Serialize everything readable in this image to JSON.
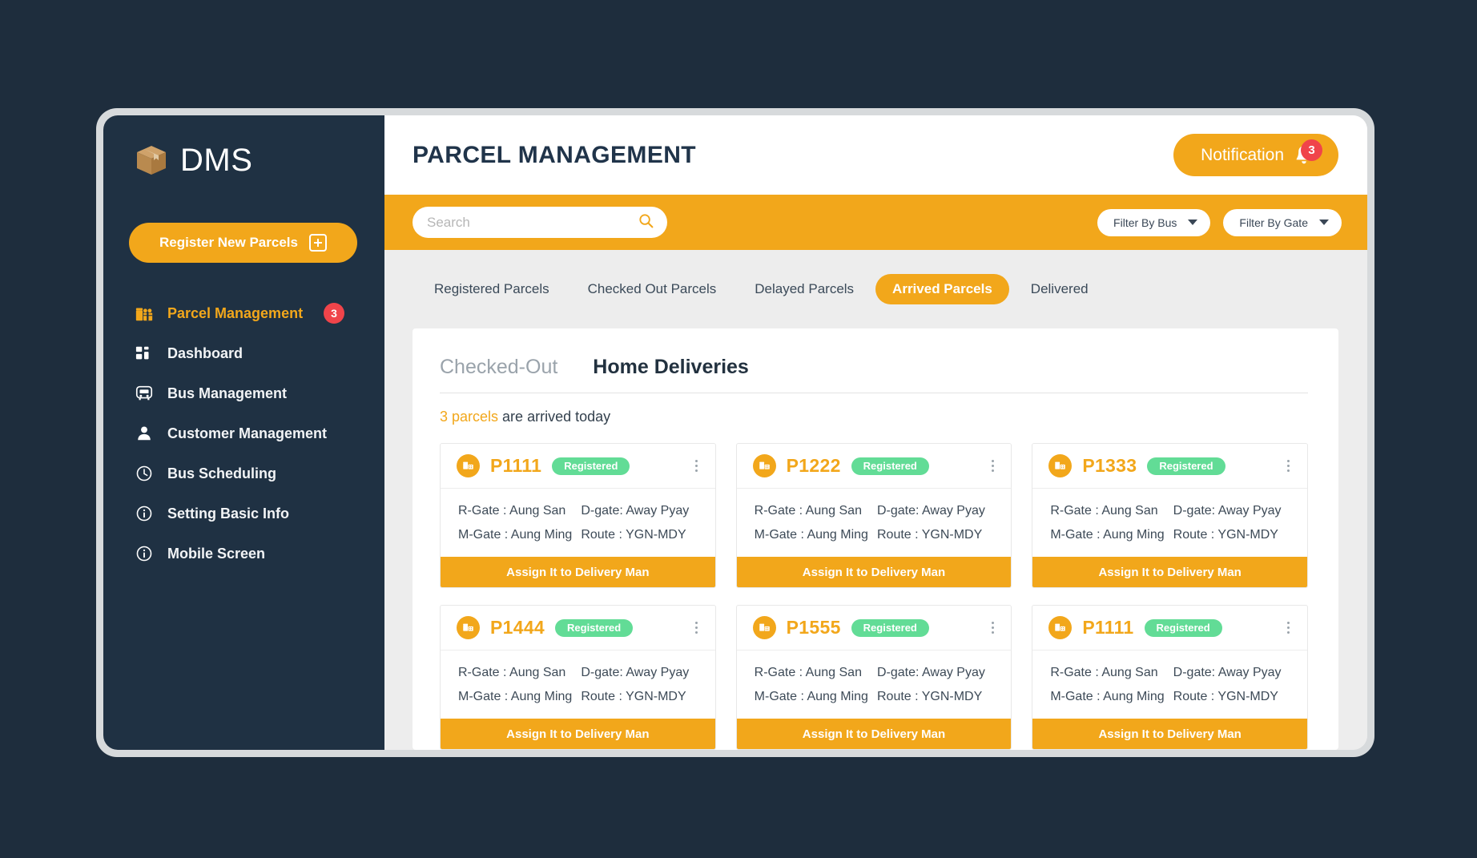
{
  "app": {
    "brand_name": "DMS",
    "brand_icon": "parcel-box-icon"
  },
  "sidebar": {
    "register_button": {
      "label": "Register New Parcels",
      "icon": "plus-square-icon"
    },
    "items": [
      {
        "label": "Parcel Management",
        "icon": "gift-boxes-icon",
        "badge": "3",
        "active": true
      },
      {
        "label": "Dashboard",
        "icon": "grid-squares-icon",
        "badge": "",
        "active": false
      },
      {
        "label": "Bus Management",
        "icon": "bus-icon",
        "badge": "",
        "active": false
      },
      {
        "label": "Customer Management",
        "icon": "user-icon",
        "badge": "",
        "active": false
      },
      {
        "label": "Bus Scheduling",
        "icon": "clock-icon",
        "badge": "",
        "active": false
      },
      {
        "label": "Setting Basic Info",
        "icon": "info-circle-icon",
        "badge": "",
        "active": false
      },
      {
        "label": "Mobile Screen",
        "icon": "info-circle-icon",
        "badge": "",
        "active": false
      }
    ]
  },
  "header": {
    "title": "PARCEL MANAGEMENT",
    "notification": {
      "label": "Notification",
      "icon": "bell-icon",
      "count": "3"
    }
  },
  "search": {
    "placeholder": "Search",
    "value": "",
    "icon": "search-icon",
    "filters": [
      {
        "label": "Filter By Bus",
        "icon": "chevron-down-icon"
      },
      {
        "label": "Filter By Gate",
        "icon": "chevron-down-icon"
      }
    ]
  },
  "tabs": [
    {
      "label": "Registered Parcels",
      "active": false
    },
    {
      "label": "Checked Out Parcels",
      "active": false
    },
    {
      "label": "Delayed Parcels",
      "active": false
    },
    {
      "label": "Arrived Parcels",
      "active": true
    },
    {
      "label": "Delivered",
      "active": false
    }
  ],
  "panel": {
    "subtabs": [
      {
        "label": "Checked-Out",
        "active": false
      },
      {
        "label": "Home Deliveries",
        "active": true
      }
    ],
    "summary": {
      "highlight": "3 parcels",
      "rest": " are arrived today"
    },
    "assign_label": "Assign It to Delivery Man",
    "cards": [
      {
        "id": "P1111",
        "status": "Registered",
        "icon": "parcel-box-icon",
        "menu_icon": "kebab-menu-icon",
        "r_gate": "R-Gate : Aung San",
        "d_gate": "D-gate: Away Pyay",
        "m_gate": "M-Gate : Aung Ming",
        "route": "Route : YGN-MDY"
      },
      {
        "id": "P1222",
        "status": "Registered",
        "icon": "parcel-box-icon",
        "menu_icon": "kebab-menu-icon",
        "r_gate": "R-Gate : Aung San",
        "d_gate": "D-gate: Away Pyay",
        "m_gate": "M-Gate : Aung Ming",
        "route": "Route : YGN-MDY"
      },
      {
        "id": "P1333",
        "status": "Registered",
        "icon": "parcel-box-icon",
        "menu_icon": "kebab-menu-icon",
        "r_gate": "R-Gate : Aung San",
        "d_gate": "D-gate: Away Pyay",
        "m_gate": "M-Gate : Aung Ming",
        "route": "Route : YGN-MDY"
      },
      {
        "id": "P1444",
        "status": "Registered",
        "icon": "parcel-box-icon",
        "menu_icon": "kebab-menu-icon",
        "r_gate": "R-Gate : Aung San",
        "d_gate": "D-gate: Away Pyay",
        "m_gate": "M-Gate : Aung Ming",
        "route": "Route : YGN-MDY"
      },
      {
        "id": "P1555",
        "status": "Registered",
        "icon": "parcel-box-icon",
        "menu_icon": "kebab-menu-icon",
        "r_gate": "R-Gate : Aung San",
        "d_gate": "D-gate: Away Pyay",
        "m_gate": "M-Gate : Aung Ming",
        "route": "Route : YGN-MDY"
      },
      {
        "id": "P1111",
        "status": "Registered",
        "icon": "parcel-box-icon",
        "menu_icon": "kebab-menu-icon",
        "r_gate": "R-Gate : Aung San",
        "d_gate": "D-gate: Away Pyay",
        "m_gate": "M-Gate : Aung Ming",
        "route": "Route : YGN-MDY"
      }
    ]
  },
  "colors": {
    "accent_orange": "#f2a71b",
    "sidebar_navy": "#1f3143",
    "page_navy": "#1e2d3d",
    "badge_red": "#f0444a",
    "status_green": "#62dc96",
    "content_gray": "#ededed"
  }
}
